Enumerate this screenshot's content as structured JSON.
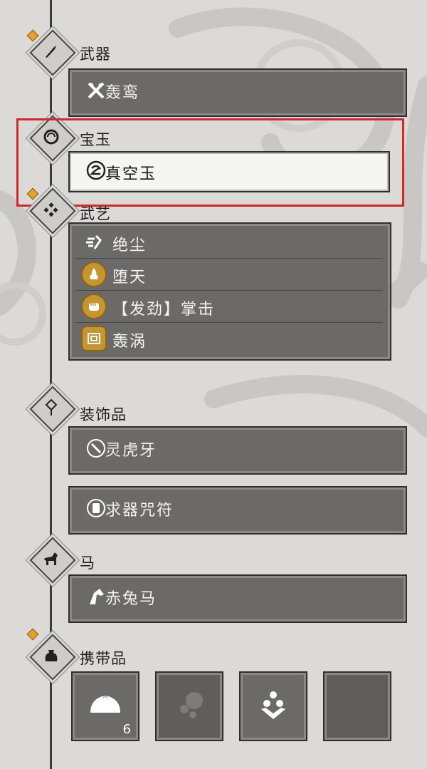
{
  "sections": {
    "weapon": {
      "title": "武器",
      "items": [
        {
          "label": "轰鸾",
          "icon": "crossed-axe-icon"
        }
      ]
    },
    "jade": {
      "title": "宝玉",
      "items": [
        {
          "label": "真空玉",
          "icon": "swirl-orb-icon",
          "selected": true
        }
      ]
    },
    "martial": {
      "title": "武艺",
      "skills": [
        {
          "label": "绝尘",
          "icon": "dash-figure-icon"
        },
        {
          "label": "堕天",
          "icon": "flame-icon"
        },
        {
          "label": "【发劲】掌击",
          "icon": "fist-icon"
        },
        {
          "label": "轰涡",
          "icon": "vortex-square-icon"
        }
      ]
    },
    "accessory": {
      "title": "装饰品",
      "items": [
        {
          "label": "灵虎牙",
          "icon": "fang-icon"
        },
        {
          "label": "求器咒符",
          "icon": "talisman-icon"
        }
      ]
    },
    "horse": {
      "title": "马",
      "items": [
        {
          "label": "赤兔马",
          "icon": "horse-head-icon"
        }
      ]
    },
    "carry": {
      "title": "携带品",
      "items": [
        {
          "icon": "bun-icon",
          "count": "6"
        },
        {
          "icon": "pouch-icon"
        },
        {
          "icon": "beads-icon"
        },
        {
          "icon": "empty-slot-icon"
        }
      ]
    }
  },
  "colors": {
    "highlight": "#d4262b",
    "accent_pip": "#e2a02c",
    "slot_bg": "#6b6a68"
  }
}
